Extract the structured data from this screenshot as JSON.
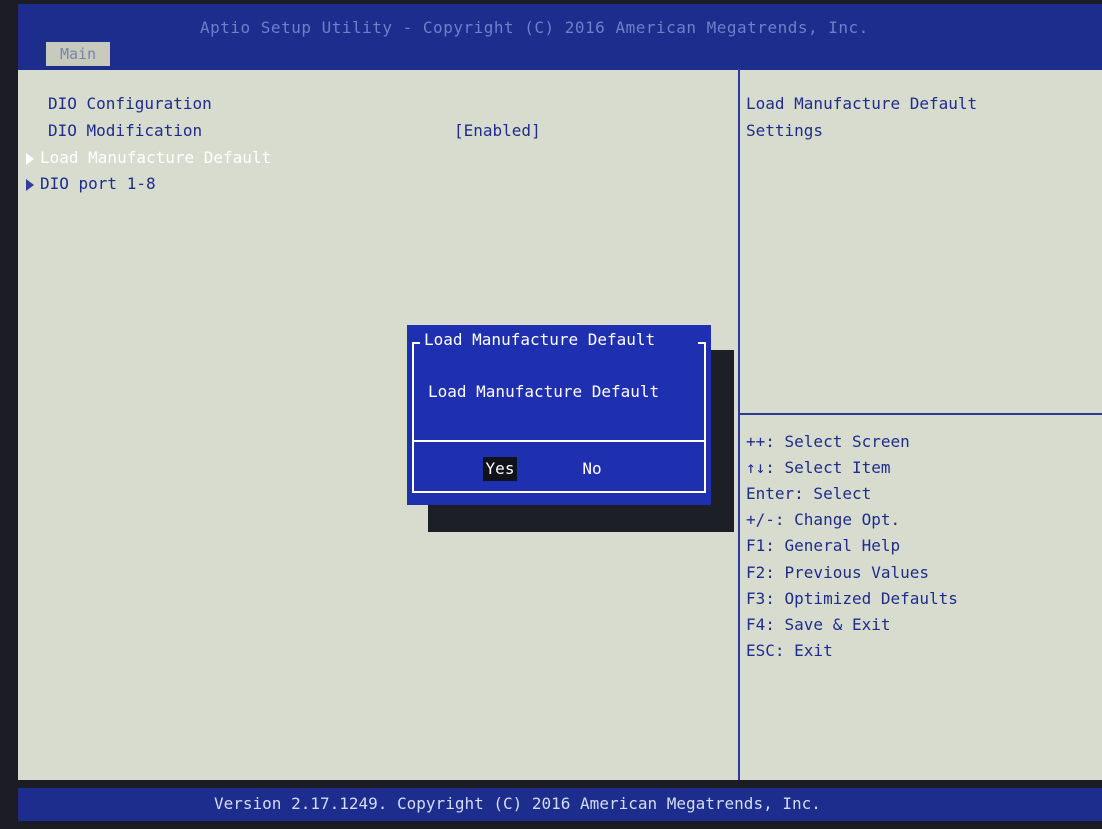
{
  "header": {
    "title": "Aptio Setup Utility - Copyright (C) 2016 American Megatrends, Inc.",
    "tab": "Main"
  },
  "main": {
    "items": [
      {
        "label": "DIO Configuration"
      },
      {
        "label": "DIO Modification",
        "value": "[Enabled]"
      },
      {
        "label": "Load Manufacture Default"
      },
      {
        "label": "DIO port 1-8"
      }
    ]
  },
  "help": {
    "description_line1": "Load Manufacture Default",
    "description_line2": "Settings",
    "keys": [
      "++: Select Screen",
      "↑↓: Select Item",
      "Enter: Select",
      "+/-: Change Opt.",
      "F1: General Help",
      "F2: Previous Values",
      "F3: Optimized Defaults",
      "F4: Save & Exit",
      "ESC: Exit"
    ]
  },
  "dialog": {
    "title": "Load Manufacture Default",
    "message": "Load Manufacture Default",
    "yes": "Yes",
    "no": "No"
  },
  "footer": {
    "text": "Version 2.17.1249. Copyright (C) 2016 American Megatrends, Inc."
  }
}
